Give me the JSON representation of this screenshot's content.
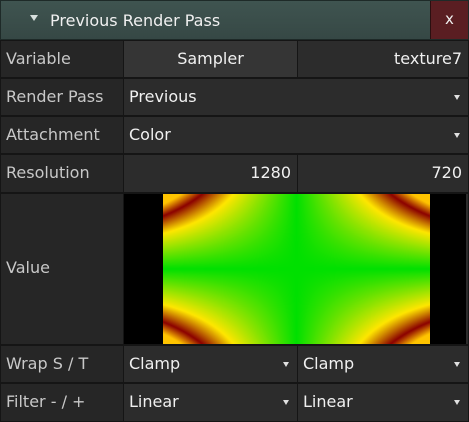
{
  "panel": {
    "title": "Previous Render Pass",
    "close_label": "x"
  },
  "rows": {
    "variable": {
      "label": "Variable",
      "type": "Sampler",
      "name": "texture7"
    },
    "render_pass": {
      "label": "Render Pass",
      "value": "Previous"
    },
    "attachment": {
      "label": "Attachment",
      "value": "Color"
    },
    "resolution": {
      "label": "Resolution",
      "width": "1280",
      "height": "720"
    },
    "value": {
      "label": "Value"
    },
    "wrap": {
      "label": "Wrap S / T",
      "s": "Clamp",
      "t": "Clamp"
    },
    "filter": {
      "label": "Filter - / +",
      "min": "Linear",
      "mag": "Linear"
    }
  },
  "colors": {
    "title_bar": "#3f5450",
    "close_button": "#5a1e22",
    "preview_center": "#00e000",
    "preview_mid": "#ffe600",
    "preview_edge": "#8b0000"
  }
}
